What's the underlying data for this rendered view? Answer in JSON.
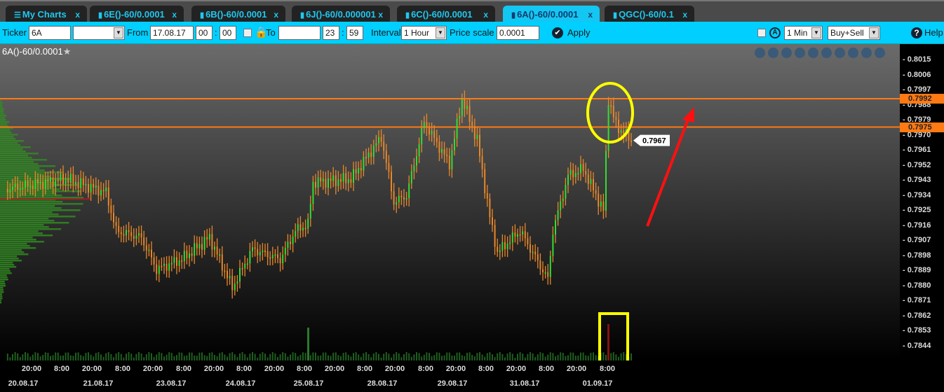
{
  "tabs": [
    {
      "label": "My Charts",
      "icon": "menu-icon",
      "active": false
    },
    {
      "label": "6E()-60/0.0001",
      "icon": "bar-chart-icon",
      "active": false
    },
    {
      "label": "6B()-60/0.0001",
      "icon": "bar-chart-icon",
      "active": false
    },
    {
      "label": "6J()-60/0.000001",
      "icon": "bar-chart-icon",
      "active": false
    },
    {
      "label": "6C()-60/0.0001",
      "icon": "bar-chart-icon",
      "active": false
    },
    {
      "label": "6A()-60/0.0001",
      "icon": "bar-chart-icon",
      "active": true
    },
    {
      "label": "QGC()-60/0.1",
      "icon": "bar-chart-icon",
      "active": false
    }
  ],
  "tab_close": "x",
  "toolbar": {
    "ticker_label": "Ticker",
    "ticker_value": "6A",
    "contract_value": "",
    "from_label": "From",
    "from_date": "17.08.17",
    "from_hour": "00",
    "from_min": "00",
    "to_label": "To",
    "to_date": "",
    "to_hour": "23",
    "to_min": "59",
    "colon": ":",
    "interval_label": "Interval",
    "interval_value": "1 Hour",
    "price_scale_label": "Price scale",
    "price_scale_value": "0.0001",
    "apply_label": "Apply",
    "timeframe_value": "1 Min",
    "side_value": "Buy+Sell",
    "help_label": "Help"
  },
  "chart_title": "6A()-60/0.0001",
  "chart_data": {
    "type": "candlestick",
    "ylim": [
      0.7838,
      0.802
    ],
    "yticks": [
      "0.8015",
      "0.8006",
      "0.7997",
      "0.7988",
      "0.7979",
      "0.7970",
      "0.7961",
      "0.7952",
      "0.7943",
      "0.7934",
      "0.7925",
      "0.7916",
      "0.7907",
      "0.7898",
      "0.7889",
      "0.7880",
      "0.7871",
      "0.7862",
      "0.7853",
      "0.7844"
    ],
    "price_path_hours": [
      3,
      26,
      42,
      46,
      56,
      62,
      72,
      83,
      92,
      100,
      111,
      117,
      122,
      124,
      139,
      151,
      156,
      161,
      168,
      178,
      183,
      189,
      194,
      197,
      206,
      217,
      219,
      225,
      231,
      239,
      241,
      244,
      250
    ],
    "price_path_values": [
      0.7938,
      0.7944,
      0.7936,
      0.7913,
      0.7909,
      0.789,
      0.7896,
      0.7909,
      0.7879,
      0.7902,
      0.7896,
      0.7913,
      0.7917,
      0.7942,
      0.7944,
      0.7969,
      0.793,
      0.7934,
      0.7978,
      0.7953,
      0.7992,
      0.7967,
      0.7921,
      0.79,
      0.7913,
      0.7884,
      0.7913,
      0.7946,
      0.795,
      0.7925,
      0.7992,
      0.7976,
      0.7967
    ],
    "horizontal_levels": [
      {
        "value": "0.7992",
        "color": "#ff7a12"
      },
      {
        "value": "0.7975",
        "color": "#ff7a12"
      }
    ],
    "last_price": "0.7967",
    "poc_price": 0.7932,
    "xticks": [
      "20:00",
      "8:00",
      "20:00",
      "8:00",
      "20:00",
      "8:00",
      "20:00",
      "8:00",
      "20:00",
      "8:00",
      "20:00",
      "8:00",
      "20:00",
      "8:00",
      "20:00",
      "8:00",
      "20:00",
      "8:00",
      "20:00",
      "8:00"
    ],
    "dates": [
      "20.08.17",
      "21.08.17",
      "23.08.17",
      "24.08.17",
      "25.08.17",
      "28.08.17",
      "29.08.17",
      "31.08.17",
      "01.09.17"
    ],
    "colors": {
      "up": "#33dd33",
      "down": "#e8872a",
      "profile": "#2f8f1f"
    }
  }
}
